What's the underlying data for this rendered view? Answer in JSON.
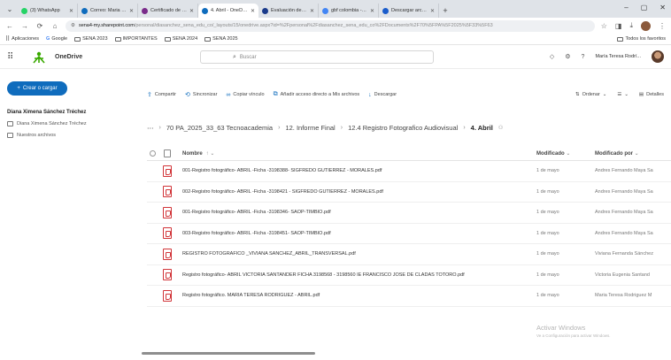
{
  "browser": {
    "tabs": [
      {
        "title": "(3) WhatsApp",
        "color": "#25d366",
        "active": false
      },
      {
        "title": "Correo: Maria Tereo",
        "color": "#0f6cbd",
        "active": false
      },
      {
        "title": "Certificado de partici",
        "color": "#7a2b8a",
        "active": false
      },
      {
        "title": "4. Abril - OneDrive",
        "color": "#0f6cbd",
        "active": true
      },
      {
        "title": "Evaluación de Fotó",
        "color": "#1a3a8a",
        "active": false
      },
      {
        "title": "gbf colombia - Bus",
        "color": "#4285f4",
        "active": false
      },
      {
        "title": "Descargar archivo",
        "color": "#1a5ccb",
        "active": false
      }
    ],
    "new_tab_label": "+",
    "window_controls": [
      "–",
      "▢",
      "✕"
    ],
    "url_domain": "sena4-my.sharepoint.com",
    "url_path": "/personal/diasanchez_sena_edu_co/_layouts/15/onedrive.aspx?id=%2Fpersonal%2Fdiasanchez_sena_edu_co%2FDocuments%2F70%5FPA%5F2025%5F33%5F63",
    "bookmarks": [
      "Aplicaciones",
      "Google",
      "SENA 2023",
      "IMPORTANTES",
      "SENA 2024",
      "SENA 2025"
    ],
    "bookmarks_right": "Todos los favoritos"
  },
  "onedrive": {
    "app_name": "OneDrive",
    "search_placeholder": "Buscar",
    "user_name": "María Teresa Rodrí..."
  },
  "leftpane": {
    "create_label": "Crear o cargar",
    "user_full": "Diana Ximena Sánchez Tréchez",
    "items": [
      "Diana Ximena Sánchez Tréchez",
      "Nuestros archivos"
    ]
  },
  "commands": {
    "share": "Compartir",
    "sync": "Sincronizar",
    "copy_link": "Copiar vínculo",
    "add_shortcut": "Añadir acceso directo a Mis archivos",
    "download": "Descargar",
    "sort": "Ordenar",
    "details": "Detalles"
  },
  "breadcrumb": {
    "items": [
      "70 PA_2025_33_63 Tecnoacademia",
      "12. Informe Final",
      "12.4 Registro Fotografico Audiovisual"
    ],
    "current": "4. Abril"
  },
  "table": {
    "headers": {
      "name": "Nombre",
      "modified": "Modificado",
      "modified_by": "Modificado por"
    },
    "rows": [
      {
        "name": "001-Registro fotográfico- ABRIL -Ficha -3198388- SIGFREDO GUTIERREZ - MORALES.pdf",
        "modified": "1 de mayo",
        "by": "Andres Fernando Maya Sa"
      },
      {
        "name": "002-Registro fotográfico- ABRIL -Ficha -3198421 - SIGFREDO GUTIERREZ - MORALES.pdf",
        "modified": "1 de mayo",
        "by": "Andres Fernando Maya Sa"
      },
      {
        "name": "001-Registro fotográfico- ABRIL -Ficha -3198346- SAOP-TIMBIO.pdf",
        "modified": "1 de mayo",
        "by": "Andres Fernando Maya Sa"
      },
      {
        "name": "003-Registro fotográfico- ABRIL -Ficha -3198451- SAOP-TIMBIO.pdf",
        "modified": "1 de mayo",
        "by": "Andres Fernando Maya Sa"
      },
      {
        "name": "REGISTRO FOTOGRAFICO _VIVIANA SANCHEZ_ABRIL_TRANSVERSAL.pdf",
        "modified": "1 de mayo",
        "by": "Viviana Fernanda Sánchez"
      },
      {
        "name": "Registro fotográfico- ABRIL VICTORIA SANTANDER FICHA 3198568 - 3198560 IE FRANCISCO JOSE DE CLADAS TOTORO.pdf",
        "modified": "1 de mayo",
        "by": "Victoria Eugenia Santand"
      },
      {
        "name": "Registro fotográfico. MARIA TERESA RODRIGUEZ - ABRIL.pdf",
        "modified": "1 de mayo",
        "by": "Maria Teresa Rodriguez M"
      }
    ]
  },
  "watermark": {
    "title": "Activar Windows",
    "subtitle": "Ve a Configuración para activar Windows."
  }
}
